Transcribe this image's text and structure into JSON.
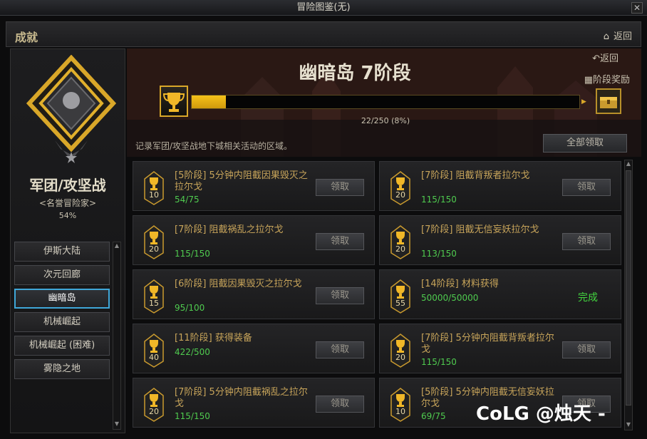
{
  "window": {
    "title": "冒险图鉴(无)",
    "close_glyph": "✕"
  },
  "header": {
    "title": "成就",
    "back_label": "返回"
  },
  "left": {
    "category_name": "军团/攻坚战",
    "rank": "<名誉冒险家>",
    "percent": "54%",
    "regions": [
      "伊斯大陆",
      "次元回廊",
      "幽暗岛",
      "机械崛起",
      "机械崛起 (困难)",
      "雾隐之地"
    ],
    "active_region": "幽暗岛"
  },
  "banner": {
    "stage_title": "幽暗岛 7阶段",
    "back_label": "返回",
    "stage_reward_label": "阶段奖励",
    "progress_text": "22/250 (8%)",
    "progress_fraction": 0.088,
    "description": "记录军团/攻坚战地下城相关活动的区域。",
    "claim_all_label": "全部领取"
  },
  "cards": [
    {
      "title": "[5阶段] 5分钟内阻截因果毁灭之拉尔戈",
      "level": "10",
      "progress": "54/75",
      "button": "领取"
    },
    {
      "title": "[7阶段] 阻截背叛者拉尔戈",
      "level": "20",
      "progress": "115/150",
      "button": "领取"
    },
    {
      "title": "[7阶段] 阻截祸乱之拉尔戈",
      "level": "20",
      "progress": "115/150",
      "button": "领取"
    },
    {
      "title": "[7阶段] 阻截无信妄妖拉尔戈",
      "level": "20",
      "progress": "113/150",
      "button": "领取"
    },
    {
      "title": "[6阶段] 阻截因果毁灭之拉尔戈",
      "level": "15",
      "progress": "95/100",
      "button": "领取"
    },
    {
      "title": "[14阶段] 材料获得",
      "level": "55",
      "progress": "50000/50000",
      "button": "完成"
    },
    {
      "title": "[11阶段] 获得装备",
      "level": "40",
      "progress": "422/500",
      "button": "领取"
    },
    {
      "title": "[7阶段] 5分钟内阻截背叛者拉尔戈",
      "level": "20",
      "progress": "115/150",
      "button": "领取"
    },
    {
      "title": "[7阶段] 5分钟内阻截祸乱之拉尔戈",
      "level": "20",
      "progress": "115/150",
      "button": "领取"
    },
    {
      "title": "[5阶段] 5分钟内阻截无信妄妖拉尔戈",
      "level": "10",
      "progress": "69/75",
      "button": "领取"
    }
  ],
  "watermark": "CoLG @烛天 -",
  "colors": {
    "accent_gold": "#f5c21a",
    "progress_green": "#4fcb4f",
    "complete_green": "#43d63f",
    "selected_blue": "#3fa7d8"
  },
  "icons": [
    "home-icon",
    "back-arrow-icon",
    "gift-icon",
    "trophy-icon",
    "emblem-icon"
  ]
}
